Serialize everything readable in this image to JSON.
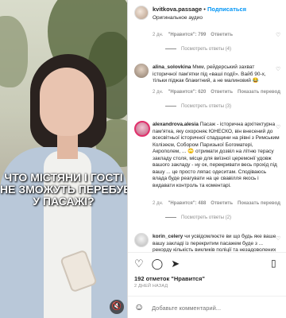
{
  "video": {
    "overlay_lines": [
      "ЧТО МІСТЯНИ І ГОСТІ",
      "НЕ ЗМОЖУТЬ ПЕРЕБУВАТИ",
      "У ПАСАЖІ?"
    ],
    "mute_icon": "speaker-muted-icon"
  },
  "header": {
    "username": "kvitkova.passage",
    "separator": "•",
    "follow_label": "Подписаться",
    "audio_label": "Оригинальное аудио"
  },
  "comments": [
    {
      "meta": {
        "age": "2 дн.",
        "likes": "\"Нравится\": 799",
        "reply": "Ответить"
      },
      "replies_label": "Посмотреть ответы (4)"
    },
    {
      "username": "alina_solovkina",
      "text": "Ммм, рейдерський захват історичної пам'ятки під «ваші події». Вайб 90-х, тільки піджак блакитний, а не малиновий 😂",
      "meta": {
        "age": "2 дн.",
        "likes": "\"Нравится\": 620",
        "reply": "Ответить",
        "translate": "Показать перевод"
      },
      "replies_label": "Посмотреть ответы (3)"
    },
    {
      "username": "alexandrova.alesia",
      "text": "Пасаж - історична архітектурна пам'ятка, яку охороняє ЮНЕСКО, він внесений до всесвітньої історичної спадщини на рівні з Римським Колізеєм, Собором Паризької Богоматері, Акрополем, ... 🙄 отримати дозвіл на літню терасу закладу столя, місце для виїзної церемонії удовж вашого закладу - ну ок, перекривати весь прохід під вашу ... це просто ляпас одеситам. Сподіваюсь влада буде реагувати на це свавілля якось і видавати контроль та коментарі.",
      "meta": {
        "age": "2 дн.",
        "likes": "\"Нравится\": 488",
        "reply": "Ответить",
        "translate": "Показать перевод"
      },
      "replies_label": "Посмотреть ответы (2)"
    },
    {
      "username": "korin_celery",
      "text": "чи усвідомлюєте ви що будь яке ваше вашу закладі із перекритим пасажем буде з ... рекорду кількість викликів поліції та незадоволених"
    }
  ],
  "actions": {
    "like_icon": "heart-icon",
    "comment_icon": "comment-icon",
    "share_icon": "share-icon",
    "save_icon": "bookmark-icon"
  },
  "footer": {
    "likes": "192 отметок \"Нравится\"",
    "posted": "2 ДНЕЙ НАЗАД",
    "emoji_icon": "smiley-icon",
    "comment_placeholder": "Добавьте комментарий..."
  }
}
